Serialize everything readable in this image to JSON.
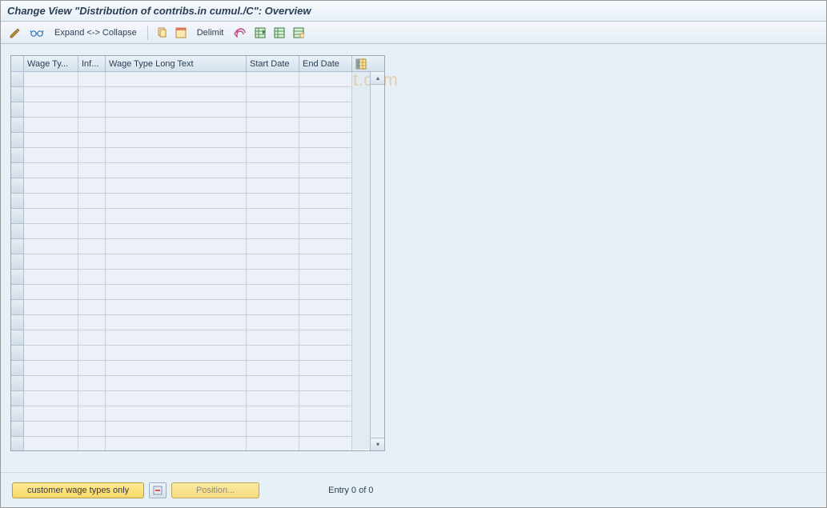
{
  "title": "Change View \"Distribution of contribs.in cumul./C\": Overview",
  "toolbar": {
    "expand_collapse_label": "Expand <-> Collapse",
    "delimit_label": "Delimit"
  },
  "columns": {
    "wage_type": "Wage Ty...",
    "inf": "Inf...",
    "long_text": "Wage Type Long Text",
    "start": "Start Date",
    "end": "End Date"
  },
  "rows": [],
  "row_count_shown": 25,
  "footer": {
    "customer_wt_label": "customer wage types only",
    "position_label": "Position...",
    "entry_status": "Entry 0 of 0"
  },
  "watermark": "© www.tutorialkart.com"
}
